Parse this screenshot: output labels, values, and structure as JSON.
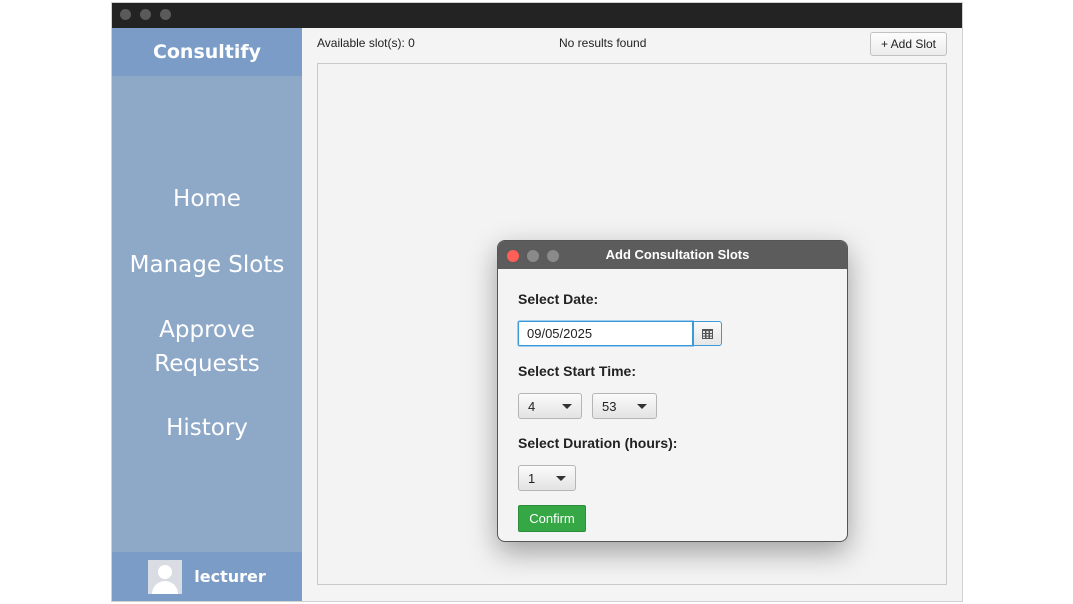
{
  "app": {
    "brand": "Consultify",
    "nav": [
      {
        "label": "Home"
      },
      {
        "label": "Manage Slots"
      },
      {
        "label": "Approve"
      },
      {
        "label": "Requests"
      },
      {
        "label": "History"
      }
    ],
    "user": {
      "name": "lecturer",
      "icon": "user-avatar-icon"
    }
  },
  "topbar": {
    "available_slots": "Available slot(s): 0",
    "status": "No results found",
    "add_slot_label": "+ Add Slot"
  },
  "dialog": {
    "title": "Add Consultation Slots",
    "date_label": "Select Date:",
    "date_value": "09/05/2025",
    "start_time_label": "Select Start Time:",
    "hour_value": "4",
    "minute_value": "53",
    "duration_label": "Select Duration (hours):",
    "duration_value": "1",
    "confirm_label": "Confirm",
    "calendar_icon": "calendar-icon"
  },
  "colors": {
    "sidebar": "#8ea8c8",
    "sidebar_header": "#7a9cc6",
    "confirm": "#35a845",
    "close_dot": "#ff5f57",
    "inactive_dot": "#8a8a8a"
  }
}
